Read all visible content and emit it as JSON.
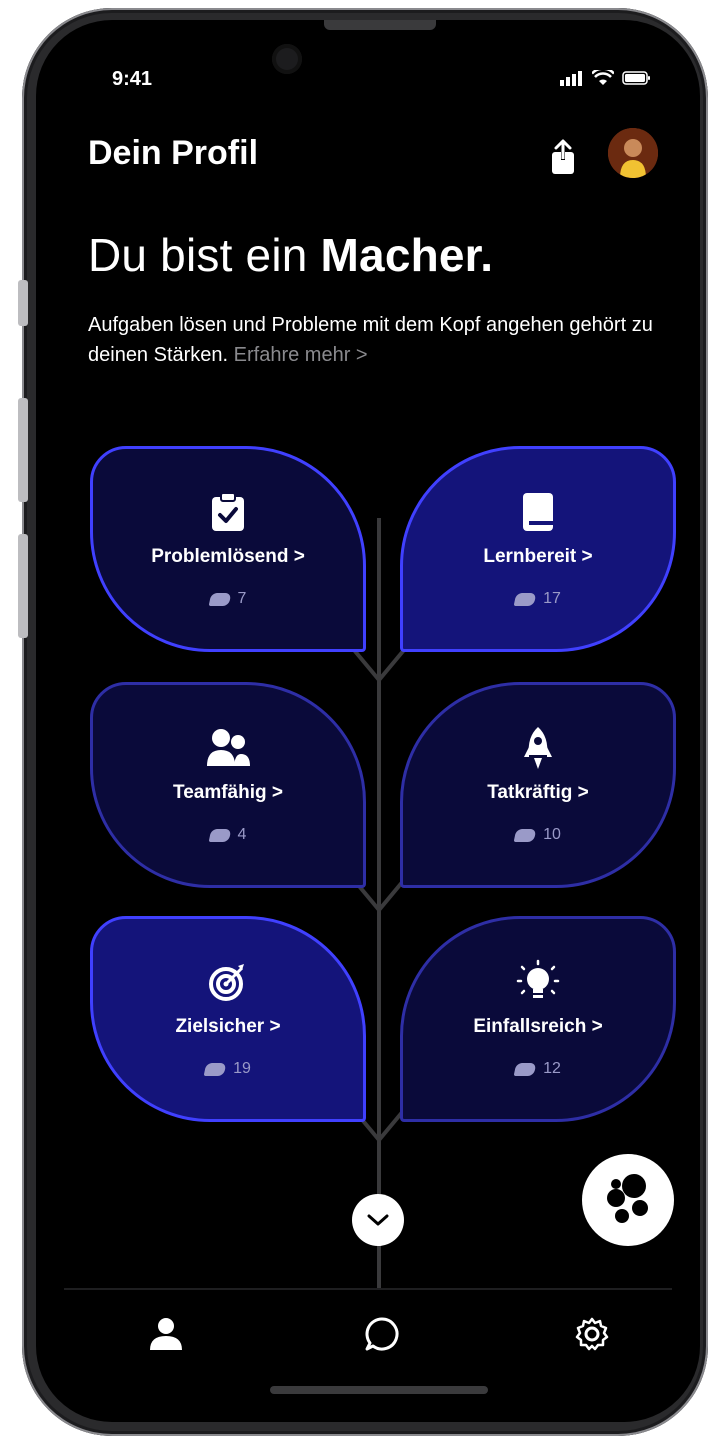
{
  "status_bar": {
    "time": "9:41"
  },
  "header": {
    "title": "Dein Profil"
  },
  "hero": {
    "headline_prefix": "Du bist ein ",
    "headline_emphasis": "Macher.",
    "description": "Aufgaben lösen und Probleme mit dem Kopf angehen gehört zu deinen Stärken. ",
    "more_link": "Erfahre mehr >"
  },
  "traits": [
    {
      "label": "Problemlösend >",
      "count": "7",
      "icon": "clipboard-check-icon"
    },
    {
      "label": "Lernbereit >",
      "count": "17",
      "icon": "book-icon"
    },
    {
      "label": "Teamfähig >",
      "count": "4",
      "icon": "people-icon"
    },
    {
      "label": "Tatkräftig >",
      "count": "10",
      "icon": "rocket-icon"
    },
    {
      "label": "Zielsicher >",
      "count": "19",
      "icon": "target-icon"
    },
    {
      "label": "Einfallsreich >",
      "count": "12",
      "icon": "lightbulb-icon"
    }
  ],
  "tabbar": {
    "items": [
      "profile-tab",
      "chat-tab",
      "settings-tab"
    ]
  },
  "colors": {
    "background": "#000000",
    "leaf_dark": "#0a0a3a",
    "leaf_bright": "#14147a",
    "leaf_border": "#2e2ea6",
    "accent": "#4040ff"
  }
}
